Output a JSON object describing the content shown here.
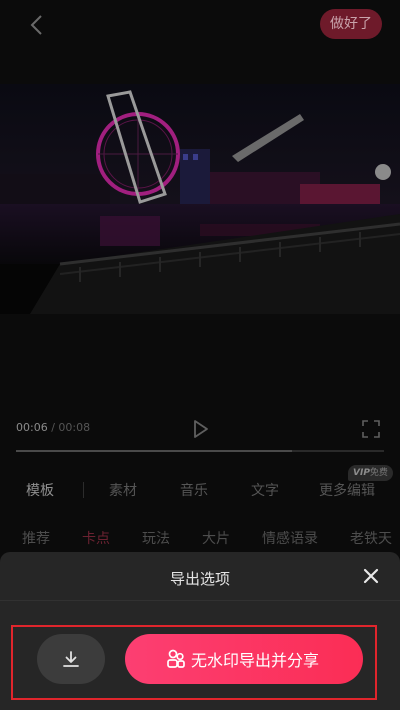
{
  "header": {
    "done_label": "做好了"
  },
  "player": {
    "current_time": "00:06",
    "separator": " / ",
    "duration": "00:08",
    "progress": 0.75
  },
  "tabs": [
    {
      "label": "模板",
      "active": true
    },
    {
      "label": "素材"
    },
    {
      "label": "音乐"
    },
    {
      "label": "文字"
    },
    {
      "label": "更多编辑"
    }
  ],
  "vip_badge": {
    "vip": "VIP",
    "text": "免费"
  },
  "subtabs": [
    {
      "label": "推荐"
    },
    {
      "label": "卡点",
      "active": true
    },
    {
      "label": "玩法"
    },
    {
      "label": "大片"
    },
    {
      "label": "情感语录"
    },
    {
      "label": "老铁天"
    }
  ],
  "export_sheet": {
    "title": "导出选项",
    "share_button_label": "无水印导出并分享"
  },
  "colors": {
    "accent": "#fc3f72",
    "highlight_border": "#e0252c",
    "sheet_bg": "#262626",
    "done_button_bg": "#6e1a2a"
  },
  "icons": [
    "back-arrow-icon",
    "play-icon",
    "fullscreen-icon",
    "close-icon",
    "download-icon",
    "share-people-icon"
  ]
}
